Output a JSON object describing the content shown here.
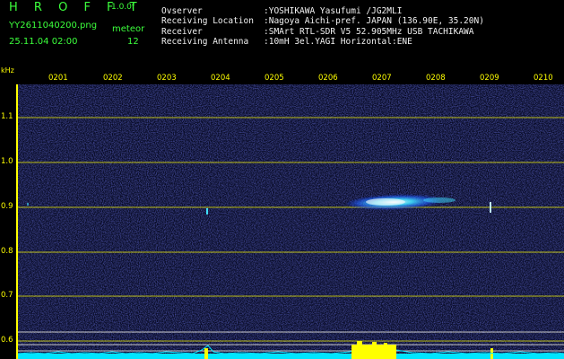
{
  "header": {
    "app_title": "H R O F F T",
    "version": "1.0.0f",
    "filename": "YY2611040200.png",
    "datetime": "25.11.04 02:00",
    "meteor_label": "meteor",
    "meteor_count": "12"
  },
  "info": [
    {
      "label": "Ovserver",
      "value": ":YOSHIKAWA Yasufumi /JG2MLI"
    },
    {
      "label": "Receiving Location",
      "value": ":Nagoya Aichi-pref. JAPAN (136.90E, 35.20N)"
    },
    {
      "label": "Receiver",
      "value": ":SMArt RTL-SDR V5 52.905MHz USB TACHIKAWA"
    },
    {
      "label": "Receiving Antenna",
      "value": ":10mH 3el.YAGI Horizontal:ENE"
    }
  ],
  "axis": {
    "unit_label": "kHz",
    "y_ticks": [
      "1.1",
      "1.0",
      "0.9",
      "0.8",
      "0.7",
      "0.6"
    ],
    "x_ticks": [
      "0201",
      "0202",
      "0203",
      "0204",
      "0205",
      "0206",
      "0207",
      "0208",
      "0209",
      "0210"
    ]
  },
  "colors": {
    "header_green": "#3cff3c",
    "info_white": "#f2f2f2",
    "axis_yellow": "#ffff00",
    "noise_blue": "#2830a0",
    "echo_cyan": "#40e0ff",
    "baseline_cyan": "#00e5ff"
  }
}
